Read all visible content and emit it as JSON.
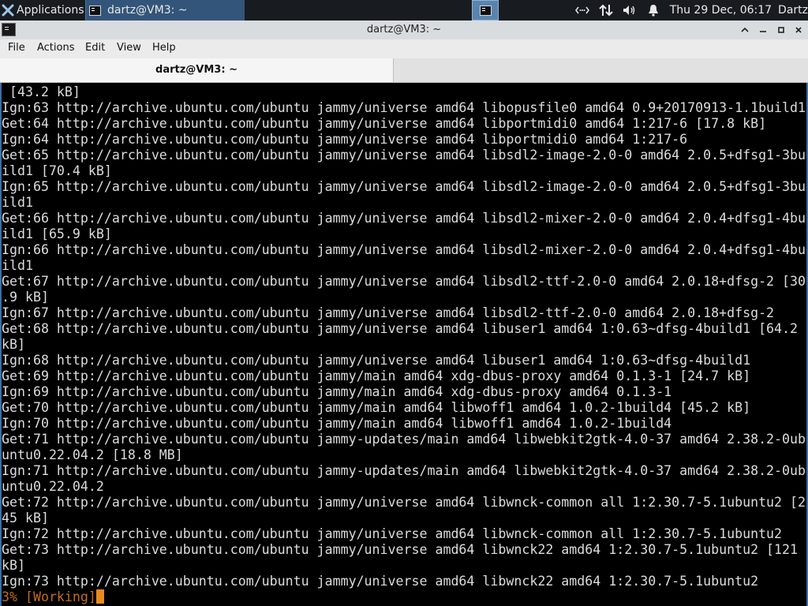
{
  "panel": {
    "applications_label": "Applications",
    "task_label": "dartz@VM3: ~",
    "clock": "Thu 29 Dec, 06:17",
    "user": "Dartz",
    "tray_icons": [
      "network-icon",
      "transfer-icon",
      "volume-icon",
      "notification-bell-icon"
    ]
  },
  "window": {
    "title": "dartz@VM3: ~"
  },
  "menubar": {
    "items": [
      "File",
      "Actions",
      "Edit",
      "View",
      "Help"
    ]
  },
  "tabs": [
    {
      "label": "dartz@VM3: ~"
    }
  ],
  "terminal": {
    "lines": [
      " [43.2 kB]",
      "Ign:63 http://archive.ubuntu.com/ubuntu jammy/universe amd64 libopusfile0 amd64 0.9+20170913-1.1build1",
      "Get:64 http://archive.ubuntu.com/ubuntu jammy/universe amd64 libportmidi0 amd64 1:217-6 [17.8 kB]",
      "Ign:64 http://archive.ubuntu.com/ubuntu jammy/universe amd64 libportmidi0 amd64 1:217-6",
      "Get:65 http://archive.ubuntu.com/ubuntu jammy/universe amd64 libsdl2-image-2.0-0 amd64 2.0.5+dfsg1-3bu",
      "ild1 [70.4 kB]",
      "Ign:65 http://archive.ubuntu.com/ubuntu jammy/universe amd64 libsdl2-image-2.0-0 amd64 2.0.5+dfsg1-3bu",
      "ild1",
      "Get:66 http://archive.ubuntu.com/ubuntu jammy/universe amd64 libsdl2-mixer-2.0-0 amd64 2.0.4+dfsg1-4bu",
      "ild1 [65.9 kB]",
      "Ign:66 http://archive.ubuntu.com/ubuntu jammy/universe amd64 libsdl2-mixer-2.0-0 amd64 2.0.4+dfsg1-4bu",
      "ild1",
      "Get:67 http://archive.ubuntu.com/ubuntu jammy/universe amd64 libsdl2-ttf-2.0-0 amd64 2.0.18+dfsg-2 [30",
      ".9 kB]",
      "Ign:67 http://archive.ubuntu.com/ubuntu jammy/universe amd64 libsdl2-ttf-2.0-0 amd64 2.0.18+dfsg-2",
      "Get:68 http://archive.ubuntu.com/ubuntu jammy/universe amd64 libuser1 amd64 1:0.63~dfsg-4build1 [64.2",
      "kB]",
      "Ign:68 http://archive.ubuntu.com/ubuntu jammy/universe amd64 libuser1 amd64 1:0.63~dfsg-4build1",
      "Get:69 http://archive.ubuntu.com/ubuntu jammy/main amd64 xdg-dbus-proxy amd64 0.1.3-1 [24.7 kB]",
      "Ign:69 http://archive.ubuntu.com/ubuntu jammy/main amd64 xdg-dbus-proxy amd64 0.1.3-1",
      "Get:70 http://archive.ubuntu.com/ubuntu jammy/main amd64 libwoff1 amd64 1.0.2-1build4 [45.2 kB]",
      "Ign:70 http://archive.ubuntu.com/ubuntu jammy/main amd64 libwoff1 amd64 1.0.2-1build4",
      "Get:71 http://archive.ubuntu.com/ubuntu jammy-updates/main amd64 libwebkit2gtk-4.0-37 amd64 2.38.2-0ub",
      "untu0.22.04.2 [18.8 MB]",
      "Ign:71 http://archive.ubuntu.com/ubuntu jammy-updates/main amd64 libwebkit2gtk-4.0-37 amd64 2.38.2-0ub",
      "untu0.22.04.2",
      "Get:72 http://archive.ubuntu.com/ubuntu jammy/universe amd64 libwnck-common all 1:2.30.7-5.1ubuntu2 [2",
      "45 kB]",
      "Ign:72 http://archive.ubuntu.com/ubuntu jammy/universe amd64 libwnck-common all 1:2.30.7-5.1ubuntu2",
      "Get:73 http://archive.ubuntu.com/ubuntu jammy/universe amd64 libwnck22 amd64 1:2.30.7-5.1ubuntu2 [121",
      "kB]",
      "Ign:73 http://archive.ubuntu.com/ubuntu jammy/universe amd64 libwnck22 amd64 1:2.30.7-5.1ubuntu2"
    ],
    "status_line": "3% [Working]"
  },
  "colors": {
    "panel_bg": "#181c21",
    "task_active": "#33557a",
    "terminal_fg": "#dcdcdc",
    "status_fg": "#c46b1e",
    "cursor": "#e98a1f"
  }
}
